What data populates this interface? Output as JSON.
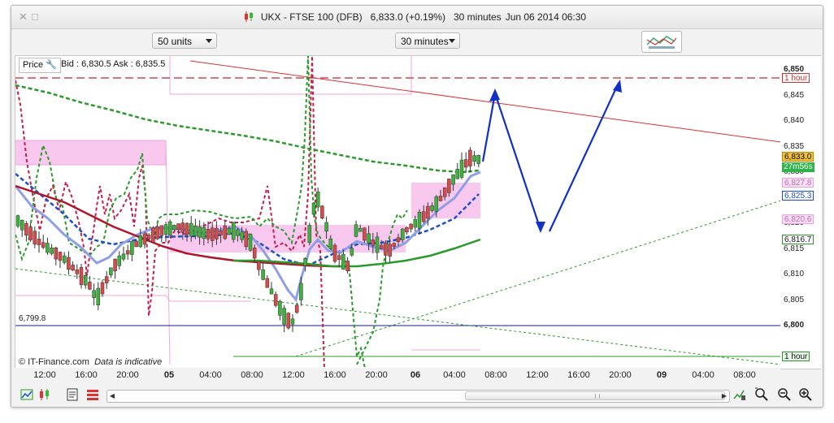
{
  "window": {
    "title_symbol": "UKX - FTSE 100 (DFB)",
    "title_price": "6,833.0 (+0.19%)",
    "title_interval": "30 minutes",
    "title_datetime": "Jun 06 2014 06:30"
  },
  "toolbar": {
    "units_select": "50 units",
    "interval_select": "30 minutes"
  },
  "chart": {
    "price_button": "Price",
    "bid_ask": "Bid : 6,830.5 Ask : 6,835.5",
    "copyright": "© IT-Finance.com",
    "disclaimer": "Data is indicative",
    "level_label": "6,799.8"
  },
  "y_axis": {
    "ticks": [
      "6,850",
      "6,845",
      "6,840",
      "6,835",
      "6,830",
      "6,825",
      "6,820",
      "6,815",
      "6,810",
      "6,805",
      "6,800"
    ],
    "badges": {
      "hour_top": "1 hour",
      "last_price": "6,833.0",
      "countdown": "27m56s",
      "pink_a": "6,827.8",
      "blue": "6,825.3",
      "pink_b": "6,820.6",
      "green": "6,816.7",
      "hour_bottom": "1 hour"
    }
  },
  "x_axis": {
    "ticks": [
      {
        "label": "12:00",
        "bold": false
      },
      {
        "label": "16:00",
        "bold": false
      },
      {
        "label": "20:00",
        "bold": false
      },
      {
        "label": "05",
        "bold": true
      },
      {
        "label": "04:00",
        "bold": false
      },
      {
        "label": "08:00",
        "bold": false
      },
      {
        "label": "12:00",
        "bold": false
      },
      {
        "label": "16:00",
        "bold": false
      },
      {
        "label": "20:00",
        "bold": false
      },
      {
        "label": "06",
        "bold": true
      },
      {
        "label": "04:00",
        "bold": false
      },
      {
        "label": "08:00",
        "bold": false
      },
      {
        "label": "12:00",
        "bold": false
      },
      {
        "label": "16:00",
        "bold": false
      },
      {
        "label": "20:00",
        "bold": false
      },
      {
        "label": "09",
        "bold": true
      },
      {
        "label": "04:00",
        "bold": false
      },
      {
        "label": "08:00",
        "bold": false
      }
    ]
  },
  "chart_data": {
    "type": "candlestick",
    "instrument": "UKX - FTSE 100 (DFB)",
    "interval": "30 minutes",
    "ylim": [
      6796,
      6852
    ],
    "y_ticks": [
      6850,
      6845,
      6840,
      6835,
      6830,
      6825,
      6820,
      6815,
      6810,
      6805,
      6800
    ],
    "levels": {
      "horizontal_blue": 6799.8,
      "red_dashed": 6848.5
    },
    "indicators": [
      {
        "name": "blue MA (dashed)",
        "value": 6825.3
      },
      {
        "name": "green MA",
        "value": 6816.7
      },
      {
        "name": "pink band upper",
        "value": 6827.8
      },
      {
        "name": "pink band lower",
        "value": 6820.6
      }
    ],
    "last": 6833.0,
    "bid": 6830.5,
    "ask": 6835.5
  },
  "colors": {
    "red_line": "#e03030",
    "green": "#2a9a2a",
    "blue_ma": "#1b4fcf",
    "light_blue": "#8f9ee8",
    "crimson": "#b0152a",
    "pink_fill": "#f9c8ef",
    "projection": "#1030c8",
    "level_line": "#1a1a8a"
  },
  "icons": [
    "close-icon",
    "minimize-icon",
    "candlestick-icon",
    "drawing-tools-icon",
    "chart-type-icon",
    "indicators-icon",
    "export-icon",
    "zoom-fit-icon",
    "zoom-out-icon",
    "zoom-in-icon"
  ]
}
